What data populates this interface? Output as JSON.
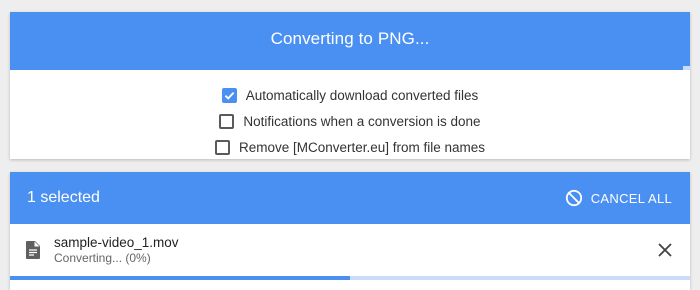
{
  "converter": {
    "title": "Converting to PNG...",
    "progress": 0.99,
    "options": [
      {
        "label": "Automatically download converted files",
        "checked": true
      },
      {
        "label": "Notifications when a conversion is done",
        "checked": false
      },
      {
        "label": "Remove [MConverter.eu] from file names",
        "checked": false
      }
    ]
  },
  "queue": {
    "selected_label": "1 selected",
    "cancel_all_label": "CANCEL ALL",
    "files": [
      {
        "name": "sample-video_1.mov",
        "status": "Converting... (0%)",
        "progress": 0.5
      }
    ]
  },
  "colors": {
    "accent": "#4a90f2",
    "track": "#c9dcf9"
  },
  "icons": {
    "check": "check-icon",
    "cancel": "block-icon",
    "file": "file-icon",
    "close": "close-icon"
  }
}
